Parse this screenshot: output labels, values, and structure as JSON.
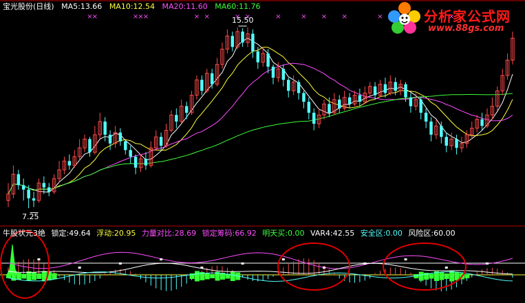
{
  "colors": {
    "background": "#000000",
    "candle_up": "#ff4a4a",
    "candle_down": "#54ffff",
    "ma5": "#ffffff",
    "ma10": "#ffff3c",
    "ma20": "#ff4dff",
    "ma60": "#3cff3c",
    "divider": "#c00000",
    "circle": "#e00000",
    "volume_block": "#33ff33"
  },
  "header": {
    "stock": "宝光股份(日线)",
    "ma5": "MA5:13.66",
    "ma10": "MA10:12.54",
    "ma20": "MA20:11.60",
    "ma60": "MA60:11.76"
  },
  "indicator_header": {
    "name": "牛股状元3绝",
    "suoding": "锁定:49.64",
    "fudong": "浮动:20.95",
    "liliang": "力量对比:28.69",
    "suoding_chouma": "锁定筹码:66.92",
    "mingtian": "明天买:0.00",
    "var4": "VAR4:42.55",
    "anquan": "安全区:0.00",
    "fengxian": "风险区:60.00"
  },
  "annotations": {
    "high_label": "15.50",
    "low_label": "7.25",
    "signal_marker": "×"
  },
  "watermark": {
    "title": "分析家公式网",
    "url": "www.88gs.com"
  },
  "chart_data": {
    "type": "candlestick",
    "y_range": [
      6.5,
      16.3
    ],
    "high": 15.5,
    "low": 7.25,
    "candles": [
      [
        7.6,
        7.9,
        7.3,
        8.4
      ],
      [
        7.9,
        8.8,
        7.7,
        9.2
      ],
      [
        8.8,
        8.3,
        8.1,
        9.0
      ],
      [
        8.3,
        8.1,
        7.6,
        8.6
      ],
      [
        8.1,
        7.7,
        7.25,
        8.3
      ],
      [
        7.7,
        7.6,
        7.3,
        8.0
      ],
      [
        7.6,
        8.4,
        7.5,
        8.6
      ],
      [
        8.4,
        8.2,
        7.9,
        8.7
      ],
      [
        8.2,
        8.0,
        7.8,
        8.4
      ],
      [
        8.0,
        8.6,
        7.9,
        8.8
      ],
      [
        8.6,
        9.0,
        8.4,
        9.4
      ],
      [
        9.0,
        9.4,
        8.8,
        9.6
      ],
      [
        9.4,
        9.2,
        9.0,
        9.7
      ],
      [
        9.2,
        9.6,
        9.1,
        9.9
      ],
      [
        9.6,
        10.0,
        9.4,
        10.4
      ],
      [
        10.0,
        10.4,
        9.8,
        10.6
      ],
      [
        10.4,
        9.8,
        9.6,
        10.5
      ],
      [
        9.8,
        10.6,
        9.7,
        11.0
      ],
      [
        10.6,
        11.2,
        10.4,
        11.6
      ],
      [
        11.2,
        10.6,
        10.3,
        11.4
      ],
      [
        10.6,
        10.2,
        9.9,
        10.8
      ],
      [
        10.2,
        10.7,
        10.0,
        11.0
      ],
      [
        10.7,
        10.3,
        10.1,
        10.9
      ],
      [
        10.3,
        9.9,
        9.7,
        10.4
      ],
      [
        9.9,
        9.6,
        9.3,
        10.1
      ],
      [
        9.6,
        9.1,
        8.8,
        9.7
      ],
      [
        9.1,
        9.5,
        8.9,
        9.7
      ],
      [
        9.5,
        9.2,
        9.0,
        9.8
      ],
      [
        9.2,
        10.0,
        9.1,
        10.3
      ],
      [
        10.0,
        10.5,
        9.9,
        10.8
      ],
      [
        10.5,
        10.1,
        9.9,
        10.7
      ],
      [
        10.1,
        10.8,
        10.0,
        11.1
      ],
      [
        10.8,
        11.5,
        10.7,
        11.7
      ],
      [
        11.5,
        11.2,
        10.9,
        11.8
      ],
      [
        11.2,
        11.9,
        11.1,
        12.2
      ],
      [
        11.9,
        11.6,
        11.3,
        12.1
      ],
      [
        11.6,
        12.4,
        11.5,
        12.6
      ],
      [
        12.4,
        13.1,
        12.2,
        13.3
      ],
      [
        13.1,
        12.6,
        12.4,
        13.3
      ],
      [
        12.6,
        13.4,
        12.5,
        13.6
      ],
      [
        13.4,
        12.9,
        12.7,
        13.6
      ],
      [
        12.9,
        13.8,
        12.8,
        14.1
      ],
      [
        13.8,
        14.5,
        13.6,
        14.8
      ],
      [
        14.5,
        15.1,
        14.3,
        15.4
      ],
      [
        15.1,
        14.6,
        14.4,
        15.3
      ],
      [
        14.6,
        15.3,
        14.5,
        15.5
      ],
      [
        15.3,
        14.8,
        14.6,
        15.45
      ],
      [
        14.8,
        15.2,
        14.6,
        15.5
      ],
      [
        15.2,
        14.4,
        14.1,
        15.4
      ],
      [
        14.4,
        13.9,
        13.6,
        14.6
      ],
      [
        13.9,
        14.3,
        13.7,
        14.6
      ],
      [
        14.3,
        13.7,
        13.4,
        14.5
      ],
      [
        13.7,
        13.2,
        12.9,
        13.8
      ],
      [
        13.2,
        13.6,
        13.0,
        13.9
      ],
      [
        13.6,
        13.1,
        12.8,
        13.8
      ],
      [
        13.1,
        12.6,
        12.3,
        13.2
      ],
      [
        12.6,
        13.0,
        12.4,
        13.3
      ],
      [
        13.0,
        12.5,
        12.2,
        13.1
      ],
      [
        12.5,
        12.1,
        11.8,
        12.6
      ],
      [
        12.1,
        11.6,
        11.3,
        12.3
      ],
      [
        11.6,
        11.1,
        10.8,
        11.8
      ],
      [
        11.1,
        11.5,
        10.9,
        11.8
      ],
      [
        11.5,
        12.0,
        11.3,
        12.2
      ],
      [
        12.0,
        11.6,
        11.4,
        12.3
      ],
      [
        11.6,
        12.2,
        11.5,
        12.5
      ],
      [
        12.2,
        11.8,
        11.6,
        12.4
      ],
      [
        11.8,
        12.3,
        11.7,
        12.6
      ],
      [
        12.3,
        12.0,
        11.8,
        12.5
      ],
      [
        12.0,
        12.4,
        11.9,
        12.6
      ],
      [
        12.4,
        12.1,
        11.9,
        12.7
      ],
      [
        12.1,
        12.5,
        12.0,
        12.8
      ],
      [
        12.5,
        12.8,
        12.3,
        13.0
      ],
      [
        12.8,
        12.4,
        12.2,
        13.0
      ],
      [
        12.4,
        12.9,
        12.3,
        13.1
      ],
      [
        12.9,
        12.5,
        12.3,
        13.2
      ],
      [
        12.5,
        13.0,
        12.4,
        13.3
      ],
      [
        13.0,
        12.6,
        12.4,
        13.2
      ],
      [
        12.6,
        12.9,
        12.4,
        13.1
      ],
      [
        12.9,
        12.3,
        12.1,
        13.0
      ],
      [
        12.3,
        11.9,
        11.6,
        12.5
      ],
      [
        11.9,
        12.2,
        11.7,
        12.5
      ],
      [
        12.2,
        11.6,
        11.3,
        12.3
      ],
      [
        11.6,
        11.2,
        10.9,
        11.8
      ],
      [
        11.2,
        10.6,
        10.3,
        11.4
      ],
      [
        10.6,
        11.0,
        10.4,
        11.3
      ],
      [
        11.0,
        10.5,
        10.2,
        11.2
      ],
      [
        10.5,
        10.1,
        9.8,
        10.7
      ],
      [
        10.1,
        10.4,
        9.9,
        10.7
      ],
      [
        10.4,
        10.0,
        9.7,
        10.6
      ],
      [
        10.0,
        10.2,
        9.8,
        10.5
      ],
      [
        10.2,
        10.6,
        10.0,
        10.8
      ],
      [
        10.6,
        10.9,
        10.4,
        11.2
      ],
      [
        10.9,
        11.3,
        10.7,
        11.5
      ],
      [
        11.3,
        11.0,
        10.8,
        11.6
      ],
      [
        11.0,
        11.5,
        10.9,
        11.8
      ],
      [
        11.5,
        11.9,
        11.3,
        12.3
      ],
      [
        11.9,
        12.6,
        11.7,
        12.8
      ],
      [
        12.6,
        13.3,
        12.4,
        13.6
      ],
      [
        13.3,
        14.0,
        13.1,
        14.3
      ],
      [
        14.0,
        15.0,
        13.8,
        15.3
      ]
    ]
  }
}
